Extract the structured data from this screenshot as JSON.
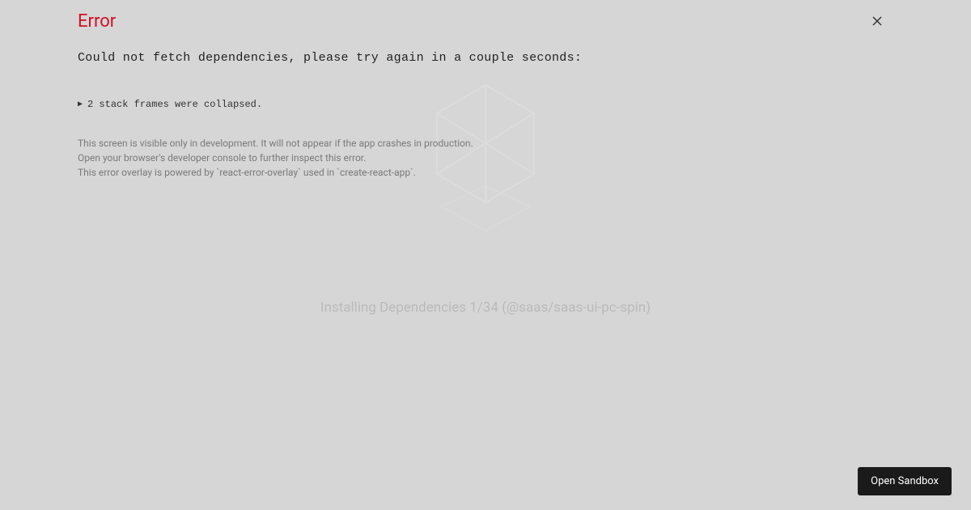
{
  "error": {
    "title": "Error",
    "message": "Could not fetch dependencies, please try again in a couple seconds:",
    "stack_collapsed_text": "2 stack frames were collapsed."
  },
  "disclaimer": {
    "line1": "This screen is visible only in development. It will not appear if the app crashes in production.",
    "line2": "Open your browser's developer console to further inspect this error.",
    "line3": "This error overlay is powered by `react-error-overlay` used in `create-react-app`."
  },
  "background": {
    "installing_text": "Installing Dependencies 1/34 (@saas/saas-ui-pc-spin)"
  },
  "buttons": {
    "open_sandbox": "Open Sandbox"
  }
}
